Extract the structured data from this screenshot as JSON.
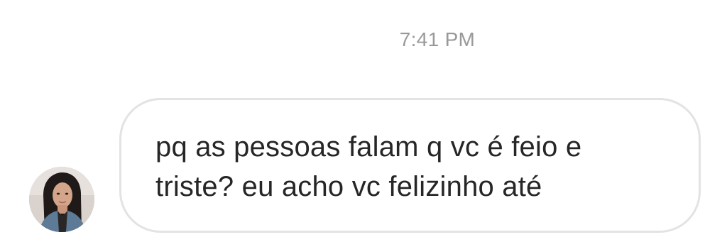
{
  "conversation": {
    "timestamp": "7:41 PM",
    "messages": [
      {
        "sender_avatar": "avatar-photo",
        "direction": "incoming",
        "line1": "pq as pessoas falam q vc é feio e",
        "line2": "triste? eu acho vc felizinho até"
      }
    ]
  },
  "colors": {
    "background": "#ffffff",
    "timestamp_text": "#999999",
    "bubble_border": "#e3e3e3",
    "message_text": "#262626"
  }
}
